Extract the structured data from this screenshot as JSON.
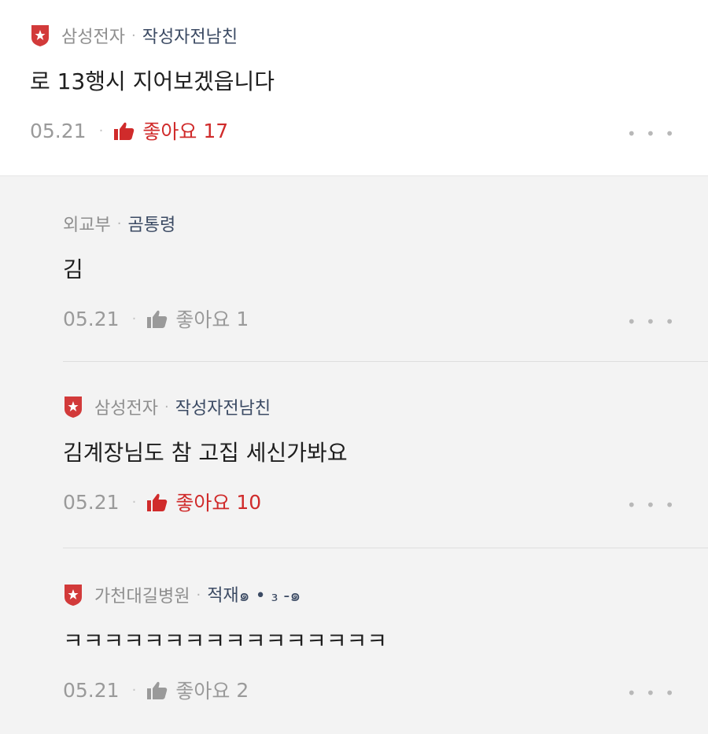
{
  "colors": {
    "like_active": "#d02b2b",
    "badge": "#d23a3a",
    "muted": "#9a9a9a",
    "nick": "#3b4a63"
  },
  "comments": [
    {
      "company": "삼성전자",
      "nickname": "작성자전남친",
      "content": "로 13행시 지어보겠읍니다",
      "date": "05.21",
      "like_label": "좋아요",
      "like_count": "17",
      "more": "• • •",
      "badge_icon": "company-badge-icon"
    },
    {
      "company": "외교부",
      "nickname": "곰통령",
      "content": "김",
      "date": "05.21",
      "like_label": "좋아요",
      "like_count": "1",
      "more": "• • •"
    },
    {
      "company": "삼성전자",
      "nickname": "작성자전남친",
      "content": "김계장님도 참 고집 세신가봐요",
      "date": "05.21",
      "like_label": "좋아요",
      "like_count": "10",
      "more": "• • •",
      "badge_icon": "company-badge-icon"
    },
    {
      "company": "가천대길병원",
      "nickname": "적재๑ • ₃ -๑",
      "content": "ㅋㅋㅋㅋㅋㅋㅋㅋㅋㅋㅋㅋㅋㅋㅋㅋ",
      "date": "05.21",
      "like_label": "좋아요",
      "like_count": "2",
      "more": "• • •",
      "badge_icon": "company-badge-icon"
    }
  ]
}
